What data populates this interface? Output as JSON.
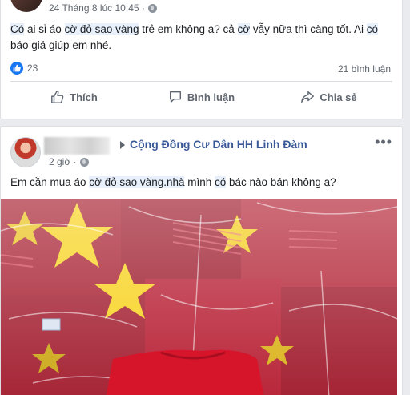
{
  "post1": {
    "timestamp": "24 Tháng 8 lúc 10:45 ·",
    "privacy_icon": "globe-icon",
    "text_parts": [
      "Có",
      " ai sỉ áo ",
      "cờ đỏ sao vàng",
      " trẻ em không ạ? cả ",
      "cờ",
      " vẫy nữa thì càng tốt. Ai ",
      "có",
      " báo giá giúp em nhé."
    ],
    "reaction_icon": "like-icon",
    "reaction_count": "23",
    "comments": "21 bình luận",
    "actions": {
      "like": "Thích",
      "comment": "Bình luận",
      "share": "Chia sẻ"
    }
  },
  "post2": {
    "group_name": "Cộng Đồng Cư Dân HH Linh Đàm",
    "time": "2 giờ ·",
    "text_parts": [
      "Em cần mua áo ",
      "cờ đỏ sao vàng.nhà",
      " mình ",
      "có",
      " bác nào bán không ạ?"
    ],
    "more_icon": "more-icon",
    "photo_icon": "photo-red-flag-shirts"
  },
  "colors": {
    "accent": "#1877f2",
    "link": "#385898",
    "shirt_red": "#c8102e",
    "star_yellow": "#f7d117"
  }
}
